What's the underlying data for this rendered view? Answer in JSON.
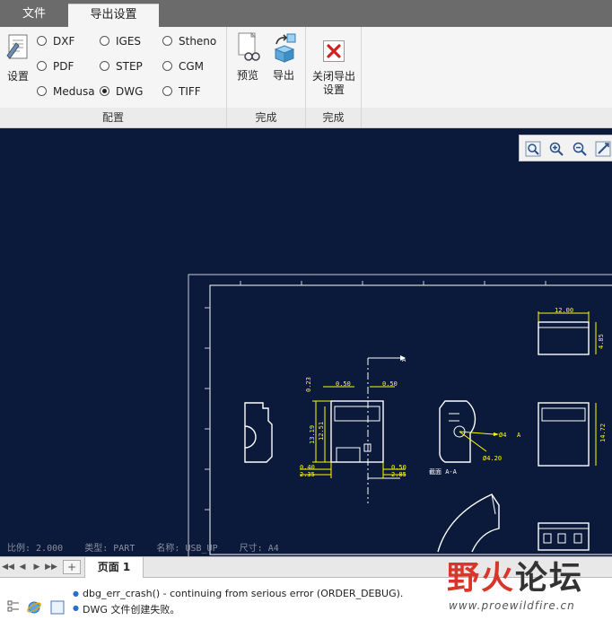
{
  "tabs": [
    {
      "label": "文件"
    },
    {
      "label": "导出设置"
    }
  ],
  "ribbon": {
    "settings_label": "设置",
    "formats": [
      {
        "label": "DXF",
        "selected": false
      },
      {
        "label": "IGES",
        "selected": false
      },
      {
        "label": "Stheno",
        "selected": false
      },
      {
        "label": "PDF",
        "selected": false
      },
      {
        "label": "STEP",
        "selected": false
      },
      {
        "label": "CGM",
        "selected": false
      },
      {
        "label": "Medusa",
        "selected": false
      },
      {
        "label": "DWG",
        "selected": true
      },
      {
        "label": "TIFF",
        "selected": false
      }
    ],
    "preview_label": "预览",
    "export_label": "导出",
    "close_label_line1": "关闭导出",
    "close_label_line2": "设置",
    "groups": {
      "config": "配置",
      "done1": "完成",
      "done2": "完成"
    }
  },
  "drawing": {
    "status_line": "比例: 2.000    类型: PART    名称: USB_UP    尺寸: A4",
    "dims": [
      "12.00",
      "4.85",
      "14.72",
      "0.50",
      "0.50",
      "0.23",
      "13.19",
      "12.51",
      "0.40",
      "2.35",
      "0.50",
      "2.85",
      "Ø4.20",
      "Ø4"
    ],
    "section_label": "截面  A-A",
    "marker_a": "A"
  },
  "pagebar": {
    "page_tab": "页面 1",
    "add": "+"
  },
  "messages": [
    "dbg_err_crash() - continuing from serious error (ORDER_DEBUG).",
    "DWG 文件创建失败。"
  ],
  "watermark": {
    "title_red": "野火",
    "title_dark": "论坛",
    "url": "www.proewildfire.cn"
  },
  "colors": {
    "canvas_bg": "#0b1a3a",
    "drawing_lines": "#ffffff",
    "dimension_color": "#ffff00",
    "watermark_red": "#d8362a"
  }
}
